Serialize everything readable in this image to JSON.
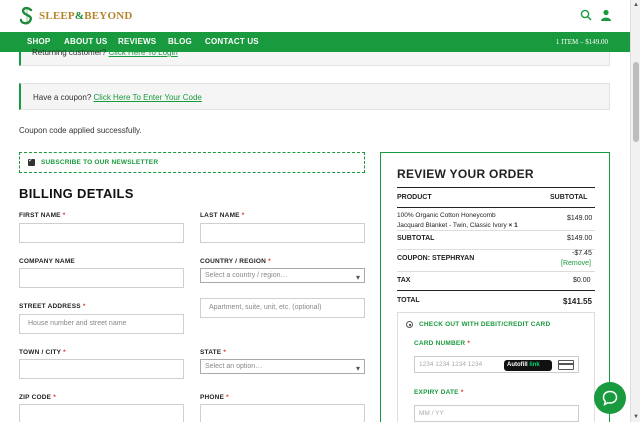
{
  "brand": {
    "name_part1": "SLEEP",
    "name_amp": "&",
    "name_part2": "BEYOND",
    "logo_letter": "S"
  },
  "header_icons": [
    "search-icon",
    "user-icon"
  ],
  "nav": {
    "items": [
      "SHOP",
      "ABOUT US",
      "REVIEWS",
      "BLOG",
      "CONTACT US"
    ],
    "cart": "1 ITEM – $149.00"
  },
  "notices": {
    "returning_prefix": "Returning customer?",
    "returning_link": "Click Here To Login",
    "coupon_prefix": "Have a coupon?",
    "coupon_link": "Click Here To Enter Your Code",
    "applied": "Coupon code applied successfully."
  },
  "newsletter": {
    "label": "SUBSCRIBE TO OUR NEWSLETTER",
    "checked": true
  },
  "billing": {
    "title": "BILLING DETAILS",
    "first_name": "FIRST NAME",
    "last_name": "LAST NAME",
    "company": "COMPANY NAME",
    "country": "COUNTRY / REGION",
    "country_placeholder": "Select a country / region…",
    "street": "STREET ADDRESS",
    "street_placeholder": "House number and street name",
    "apartment_placeholder": "Apartment, suite, unit, etc. (optional)",
    "town": "TOWN / CITY",
    "state": "STATE",
    "state_placeholder": "Select an option…",
    "zip": "ZIP CODE",
    "phone": "PHONE",
    "required_mark": "*"
  },
  "review": {
    "title": "REVIEW YOUR ORDER",
    "col_product": "PRODUCT",
    "col_subtotal": "SUBTOTAL",
    "item_line1": "100% Organic Cotton Honeycomb",
    "item_line2": "Jacquard Blanket - Twin, Classic Ivory",
    "item_qty": "× 1",
    "item_price": "$149.00",
    "subtotal_label": "SUBTOTAL",
    "subtotal_value": "$149.00",
    "coupon_label": "COUPON: STEPHRYAN",
    "coupon_value": "-$7.45",
    "coupon_remove": "[Remove]",
    "tax_label": "TAX",
    "tax_value": "$0.00",
    "total_label": "TOTAL",
    "total_value": "$141.55"
  },
  "payment": {
    "method": "CHECK OUT WITH DEBIT/CREDIT CARD",
    "card_number_label": "CARD NUMBER",
    "card_number_placeholder": "1234 1234 1234 1234",
    "autofill_text": "Autofill",
    "autofill_link": "link",
    "expiry_label": "EXPIRY DATE",
    "expiry_placeholder": "MM / YY"
  },
  "colors": {
    "brand_green": "#1a9a3e",
    "brand_gold": "#b5852c",
    "required_red": "#d33333"
  }
}
